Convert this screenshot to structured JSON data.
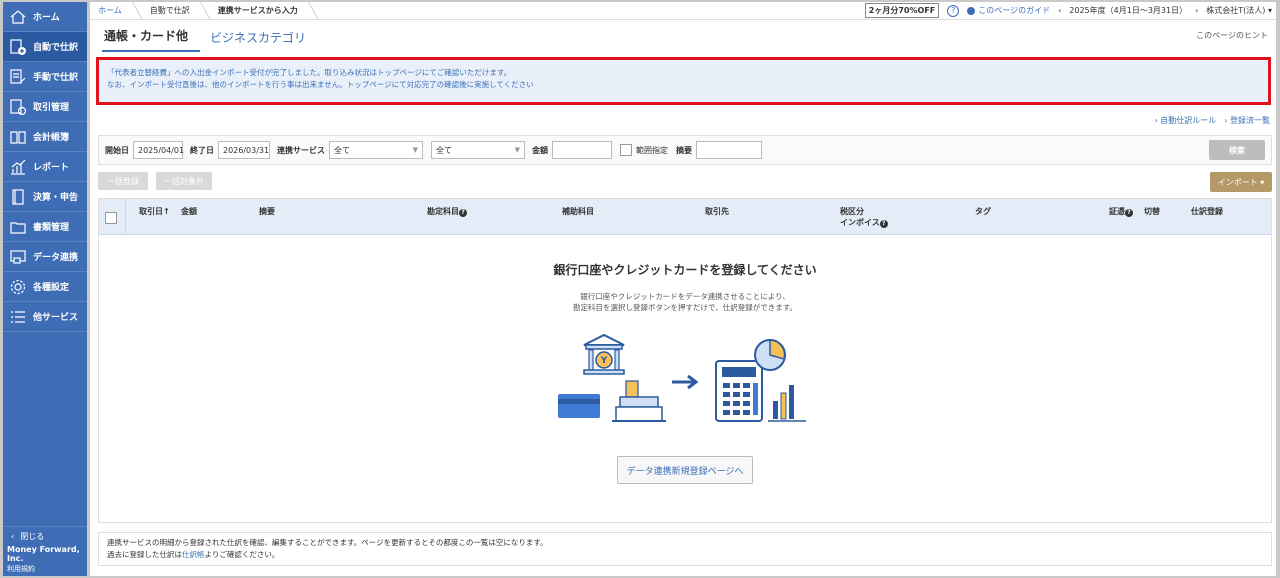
{
  "sidebar": {
    "items": [
      {
        "label": "ホーム",
        "icon": "home-icon"
      },
      {
        "label": "自動で仕訳",
        "icon": "auto-journal-icon",
        "active": true
      },
      {
        "label": "手動で仕訳",
        "icon": "manual-journal-icon"
      },
      {
        "label": "取引管理",
        "icon": "transaction-icon"
      },
      {
        "label": "会計帳簿",
        "icon": "ledger-icon"
      },
      {
        "label": "レポート",
        "icon": "report-icon"
      },
      {
        "label": "決算・申告",
        "icon": "settlement-icon"
      },
      {
        "label": "書類管理",
        "icon": "folder-icon"
      },
      {
        "label": "データ連携",
        "icon": "data-link-icon"
      },
      {
        "label": "各種設定",
        "icon": "gear-icon"
      },
      {
        "label": "他サービス",
        "icon": "list-icon"
      }
    ],
    "close_label": "閉じる",
    "brand": "Money Forward, Inc.",
    "terms": "利用規約"
  },
  "topbar": {
    "crumbs": [
      "ホーム",
      "自動で仕訳",
      "連携サービスから入力"
    ],
    "promo": "2ヶ月分70%OFF",
    "guide": "このページのガイド",
    "fiscal_year": "2025年度（4月1日〜3月31日）",
    "company": "株式会社T(法人)"
  },
  "tabs": {
    "active": "通帳・カード他",
    "other": "ビジネスカテゴリ",
    "hint": "このページのヒント"
  },
  "notice": {
    "line1": "「代表者立替経費」への入出金インポート受付が完了しました。取り込み状況はトップページにてご確認いただけます。",
    "line2": "なお、インポート受付直後は、他のインポートを行う事は出来ません。トップページにて対応完了の確認後に実施してください"
  },
  "links": {
    "auto_rule": "自動仕訳ルール",
    "registered_list": "登録済一覧"
  },
  "filter": {
    "start_label": "開始日",
    "start_value": "2025/04/01",
    "end_label": "終了日",
    "end_value": "2026/03/31",
    "service_label": "連携サービス",
    "service_value": "全て",
    "sub_value": "全て",
    "amount_label": "金額",
    "range_label": "範囲指定",
    "memo_label": "摘要",
    "search_button": "検索"
  },
  "actions": {
    "bulk_register": "一括登録",
    "bulk_exclude": "一括対象外",
    "import": "インポート ▾"
  },
  "table": {
    "headers": {
      "date": "取引日↑",
      "amount": "金額",
      "memo": "摘要",
      "account": "勘定科目",
      "sub_account": "補助科目",
      "partner": "取引先",
      "tax": "税区分",
      "invoice": "インボイス",
      "tag": "タグ",
      "evidence": "証憑",
      "switch": "切替",
      "register": "仕訳登録"
    }
  },
  "empty_state": {
    "title": "銀行口座やクレジットカードを登録してください",
    "desc1": "銀行口座やクレジットカードをデータ連携させることにより、",
    "desc2": "勘定科目を選択し登録ボタンを押すだけで、仕訳登録ができます。",
    "button": "データ連携新規登録ページへ",
    "bank_mark": "Y"
  },
  "footer": {
    "line1": "連携サービスの明細から登録された仕訳を確認、編集することができます。ページを更新するとその都度この一覧は空になります。",
    "line2_prefix": "過去に登録した仕訳は",
    "line2_link": "仕訳帳",
    "line2_suffix": "よりご確認ください。"
  },
  "colors": {
    "sidebar": "#3e6db5",
    "accent": "#3a6fb7",
    "notice_border": "#e0131a",
    "import_button": "#b59a67"
  }
}
